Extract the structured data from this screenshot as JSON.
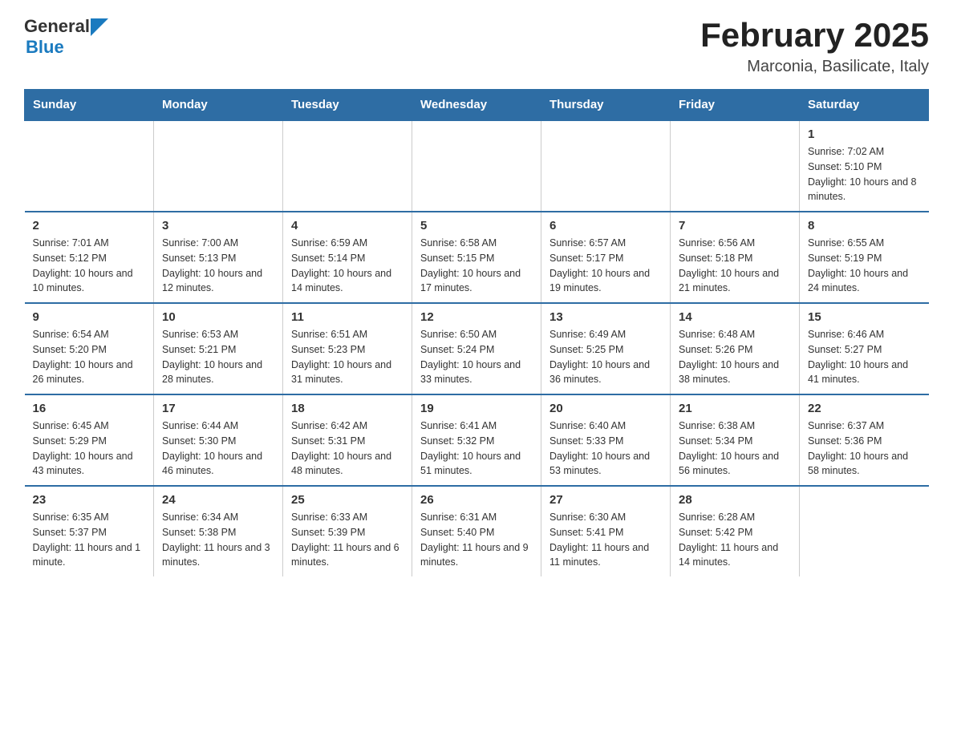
{
  "header": {
    "logo_general": "General",
    "logo_blue": "Blue",
    "title": "February 2025",
    "subtitle": "Marconia, Basilicate, Italy"
  },
  "weekdays": [
    "Sunday",
    "Monday",
    "Tuesday",
    "Wednesday",
    "Thursday",
    "Friday",
    "Saturday"
  ],
  "weeks": [
    [
      {
        "day": "",
        "info": ""
      },
      {
        "day": "",
        "info": ""
      },
      {
        "day": "",
        "info": ""
      },
      {
        "day": "",
        "info": ""
      },
      {
        "day": "",
        "info": ""
      },
      {
        "day": "",
        "info": ""
      },
      {
        "day": "1",
        "info": "Sunrise: 7:02 AM\nSunset: 5:10 PM\nDaylight: 10 hours and 8 minutes."
      }
    ],
    [
      {
        "day": "2",
        "info": "Sunrise: 7:01 AM\nSunset: 5:12 PM\nDaylight: 10 hours and 10 minutes."
      },
      {
        "day": "3",
        "info": "Sunrise: 7:00 AM\nSunset: 5:13 PM\nDaylight: 10 hours and 12 minutes."
      },
      {
        "day": "4",
        "info": "Sunrise: 6:59 AM\nSunset: 5:14 PM\nDaylight: 10 hours and 14 minutes."
      },
      {
        "day": "5",
        "info": "Sunrise: 6:58 AM\nSunset: 5:15 PM\nDaylight: 10 hours and 17 minutes."
      },
      {
        "day": "6",
        "info": "Sunrise: 6:57 AM\nSunset: 5:17 PM\nDaylight: 10 hours and 19 minutes."
      },
      {
        "day": "7",
        "info": "Sunrise: 6:56 AM\nSunset: 5:18 PM\nDaylight: 10 hours and 21 minutes."
      },
      {
        "day": "8",
        "info": "Sunrise: 6:55 AM\nSunset: 5:19 PM\nDaylight: 10 hours and 24 minutes."
      }
    ],
    [
      {
        "day": "9",
        "info": "Sunrise: 6:54 AM\nSunset: 5:20 PM\nDaylight: 10 hours and 26 minutes."
      },
      {
        "day": "10",
        "info": "Sunrise: 6:53 AM\nSunset: 5:21 PM\nDaylight: 10 hours and 28 minutes."
      },
      {
        "day": "11",
        "info": "Sunrise: 6:51 AM\nSunset: 5:23 PM\nDaylight: 10 hours and 31 minutes."
      },
      {
        "day": "12",
        "info": "Sunrise: 6:50 AM\nSunset: 5:24 PM\nDaylight: 10 hours and 33 minutes."
      },
      {
        "day": "13",
        "info": "Sunrise: 6:49 AM\nSunset: 5:25 PM\nDaylight: 10 hours and 36 minutes."
      },
      {
        "day": "14",
        "info": "Sunrise: 6:48 AM\nSunset: 5:26 PM\nDaylight: 10 hours and 38 minutes."
      },
      {
        "day": "15",
        "info": "Sunrise: 6:46 AM\nSunset: 5:27 PM\nDaylight: 10 hours and 41 minutes."
      }
    ],
    [
      {
        "day": "16",
        "info": "Sunrise: 6:45 AM\nSunset: 5:29 PM\nDaylight: 10 hours and 43 minutes."
      },
      {
        "day": "17",
        "info": "Sunrise: 6:44 AM\nSunset: 5:30 PM\nDaylight: 10 hours and 46 minutes."
      },
      {
        "day": "18",
        "info": "Sunrise: 6:42 AM\nSunset: 5:31 PM\nDaylight: 10 hours and 48 minutes."
      },
      {
        "day": "19",
        "info": "Sunrise: 6:41 AM\nSunset: 5:32 PM\nDaylight: 10 hours and 51 minutes."
      },
      {
        "day": "20",
        "info": "Sunrise: 6:40 AM\nSunset: 5:33 PM\nDaylight: 10 hours and 53 minutes."
      },
      {
        "day": "21",
        "info": "Sunrise: 6:38 AM\nSunset: 5:34 PM\nDaylight: 10 hours and 56 minutes."
      },
      {
        "day": "22",
        "info": "Sunrise: 6:37 AM\nSunset: 5:36 PM\nDaylight: 10 hours and 58 minutes."
      }
    ],
    [
      {
        "day": "23",
        "info": "Sunrise: 6:35 AM\nSunset: 5:37 PM\nDaylight: 11 hours and 1 minute."
      },
      {
        "day": "24",
        "info": "Sunrise: 6:34 AM\nSunset: 5:38 PM\nDaylight: 11 hours and 3 minutes."
      },
      {
        "day": "25",
        "info": "Sunrise: 6:33 AM\nSunset: 5:39 PM\nDaylight: 11 hours and 6 minutes."
      },
      {
        "day": "26",
        "info": "Sunrise: 6:31 AM\nSunset: 5:40 PM\nDaylight: 11 hours and 9 minutes."
      },
      {
        "day": "27",
        "info": "Sunrise: 6:30 AM\nSunset: 5:41 PM\nDaylight: 11 hours and 11 minutes."
      },
      {
        "day": "28",
        "info": "Sunrise: 6:28 AM\nSunset: 5:42 PM\nDaylight: 11 hours and 14 minutes."
      },
      {
        "day": "",
        "info": ""
      }
    ]
  ]
}
